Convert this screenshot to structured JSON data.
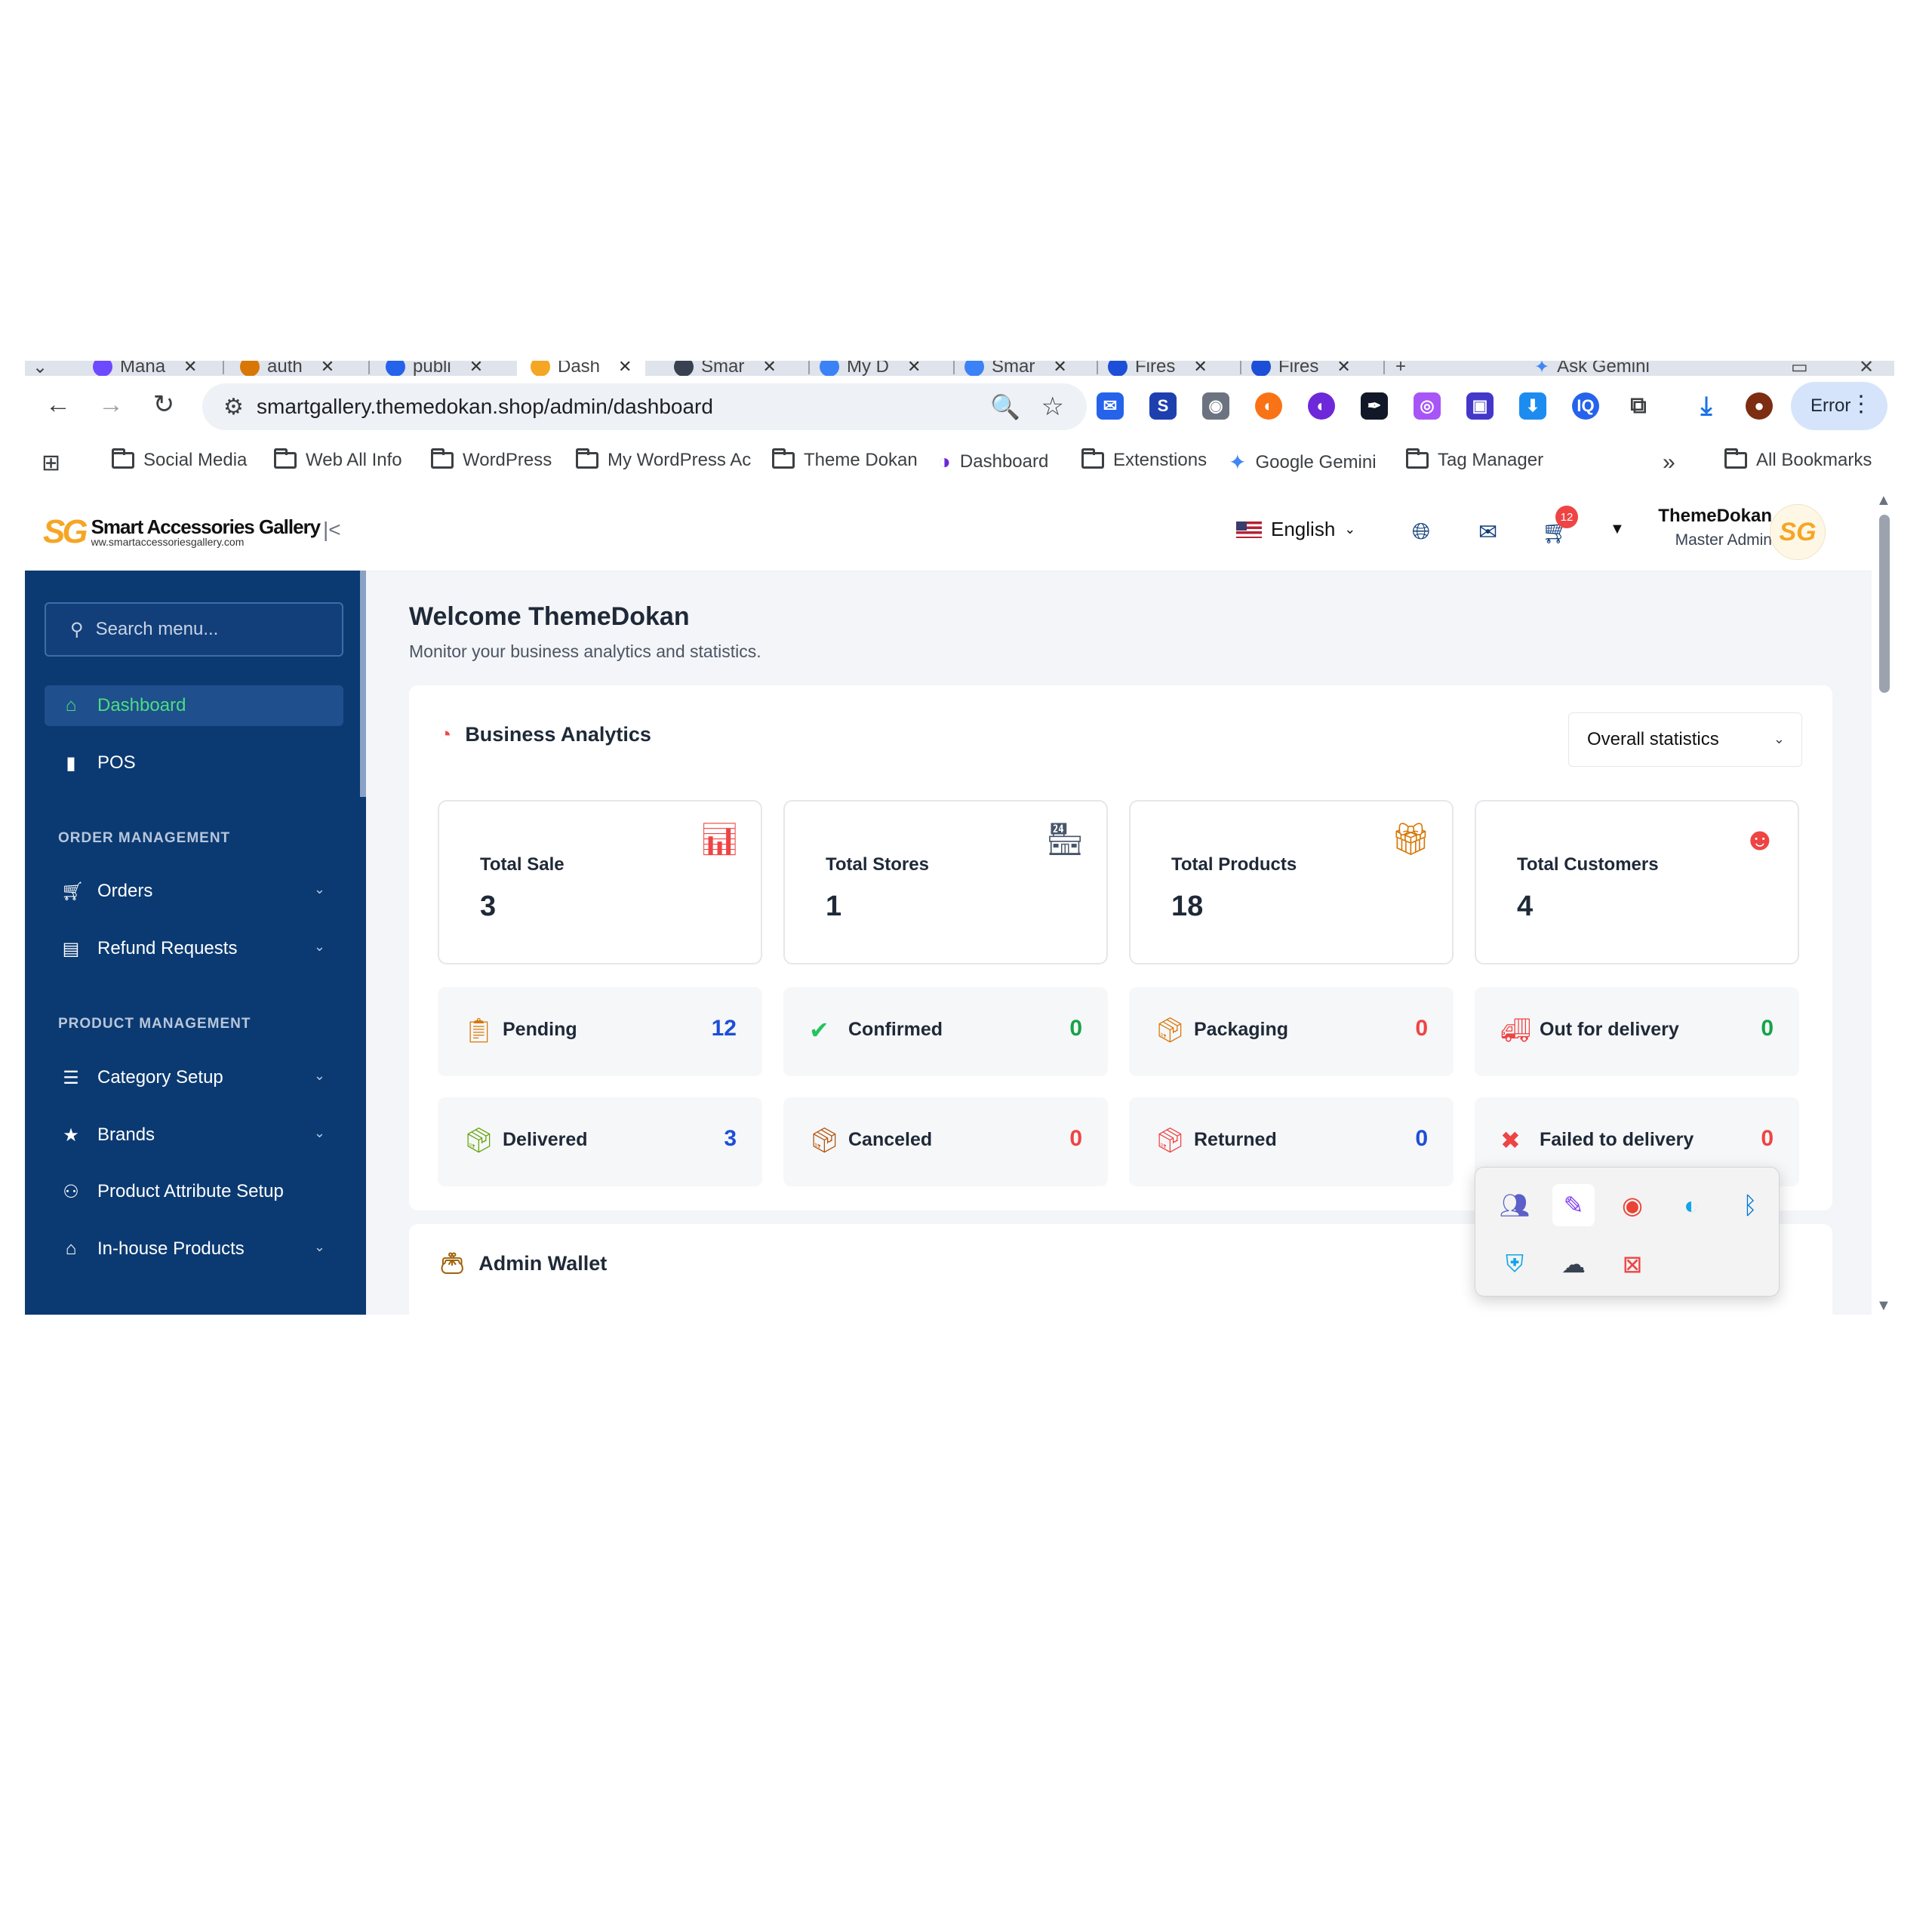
{
  "browser": {
    "tabs": [
      {
        "label": "Mana",
        "color": "#6d4aff"
      },
      {
        "label": "auth",
        "color": "#d97706"
      },
      {
        "label": "publi",
        "color": "#2563eb"
      },
      {
        "label": "Dash",
        "color": "#f5a623",
        "active": true
      },
      {
        "label": "Smar",
        "color": "#374151"
      },
      {
        "label": "My D",
        "color": "#3b82f6"
      },
      {
        "label": "Smar",
        "color": "#3b82f6"
      },
      {
        "label": "Fires",
        "color": "#1d4ed8"
      },
      {
        "label": "Fires",
        "color": "#1d4ed8"
      }
    ],
    "tab_close": "✕",
    "new_tab": "+",
    "ask_gemini": "Ask Gemini",
    "url": "smartgallery.themedokan.shop/admin/dashboard",
    "error_label": "Error",
    "bookmarks": [
      "Social Media",
      "Web All Info",
      "WordPress",
      "My WordPress Ac",
      "Theme Dokan",
      "Dashboard",
      "Extenstions",
      "Google Gemini",
      "Tag Manager"
    ],
    "more_bookmarks": "»",
    "all_bookmarks": "All Bookmarks"
  },
  "header": {
    "logo_mark": "SG",
    "logo_title": "Smart Accessories Gallery",
    "logo_subtitle": "ww.smartaccessoriesgallery.com",
    "language": "English",
    "cart_count": "12",
    "user_name": "ThemeDokan",
    "user_role": "Master Admin",
    "avatar_text": "SG"
  },
  "sidebar": {
    "search_placeholder": "Search menu...",
    "items": [
      {
        "label": "Dashboard",
        "icon": "home-icon"
      },
      {
        "label": "POS",
        "icon": "bag-icon"
      }
    ],
    "sections": [
      {
        "title": "ORDER MANAGEMENT",
        "items": [
          {
            "label": "Orders",
            "icon": "cart-icon"
          },
          {
            "label": "Refund Requests",
            "icon": "receipt-icon"
          }
        ]
      },
      {
        "title": "PRODUCT MANAGEMENT",
        "items": [
          {
            "label": "Category Setup",
            "icon": "filter-icon"
          },
          {
            "label": "Brands",
            "icon": "star-icon"
          },
          {
            "label": "Product Attribute Setup",
            "icon": "hierarchy-icon"
          },
          {
            "label": "In-house Products",
            "icon": "store-icon"
          }
        ]
      }
    ]
  },
  "main": {
    "welcome": "Welcome ThemeDokan",
    "subtitle": "Monitor your business analytics and statistics.",
    "analytics_title": "Business Analytics",
    "filter": "Overall statistics",
    "stats": [
      {
        "label": "Total Sale",
        "value": "3"
      },
      {
        "label": "Total Stores",
        "value": "1"
      },
      {
        "label": "Total Products",
        "value": "18"
      },
      {
        "label": "Total Customers",
        "value": "4"
      }
    ],
    "order_status": [
      {
        "label": "Pending",
        "value": "12",
        "color": "#1d4ed8"
      },
      {
        "label": "Confirmed",
        "value": "0",
        "color": "#16a34a"
      },
      {
        "label": "Packaging",
        "value": "0",
        "color": "#ef4444"
      },
      {
        "label": "Out for delivery",
        "value": "0",
        "color": "#16a34a"
      },
      {
        "label": "Delivered",
        "value": "3",
        "color": "#1d4ed8"
      },
      {
        "label": "Canceled",
        "value": "0",
        "color": "#ef4444"
      },
      {
        "label": "Returned",
        "value": "0",
        "color": "#1d4ed8"
      },
      {
        "label": "Failed to delivery",
        "value": "0",
        "color": "#ef4444"
      }
    ],
    "wallet_title": "Admin Wallet"
  }
}
